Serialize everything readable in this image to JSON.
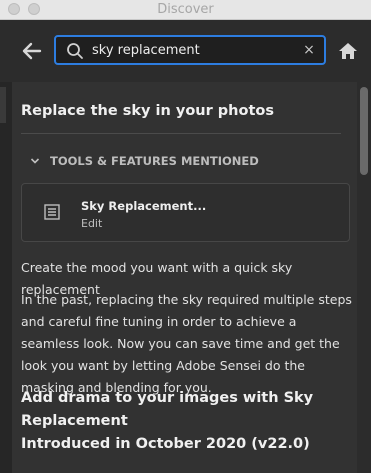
{
  "window": {
    "title": "Discover"
  },
  "search": {
    "value": "sky replacement",
    "clear_symbol": "×"
  },
  "article": {
    "title": "Replace the sky in your photos",
    "tools_header": "TOOLS & FEATURES MENTIONED",
    "tool": {
      "name": "Sky Replacement...",
      "menu": "Edit",
      "icon": "menu-list-icon"
    },
    "paragraph1": "Create the mood you want with a quick sky replacement",
    "paragraph2": "In the past, replacing the sky required multiple steps and careful fine tuning in order to achieve a seamless look. Now you can save time and get the look you want by letting Adobe Sensei do the masking and blending for you.",
    "heading2": "Add drama to your images with Sky Replacement",
    "heading2_sub": "Introduced in October 2020 (v22.0)"
  },
  "colors": {
    "accent": "#2d7de0",
    "background": "#323232"
  },
  "icons": {
    "back": "back-arrow-icon",
    "search": "search-icon",
    "clear": "close-icon",
    "home": "home-icon",
    "collapse": "chevron-down-icon"
  }
}
